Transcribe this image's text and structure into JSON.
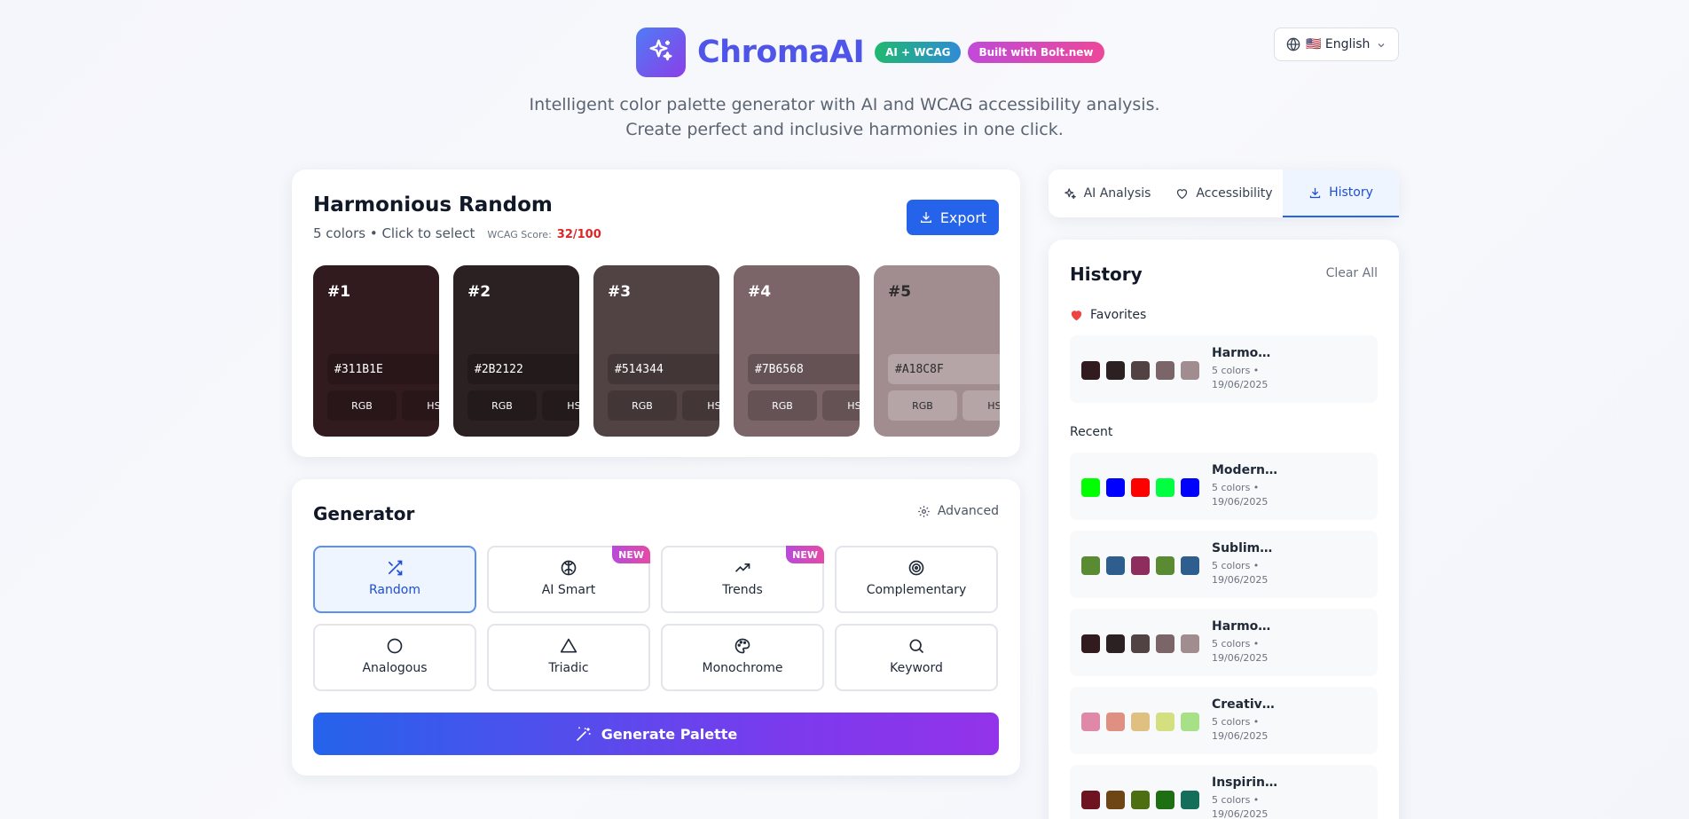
{
  "header": {
    "app_name": "ChromaAI",
    "badges": [
      "AI + WCAG",
      "Built with Bolt.new"
    ],
    "language": "🇺🇸 English",
    "tagline": [
      "Intelligent color palette generator with AI and WCAG accessibility analysis.",
      "Create perfect and inclusive harmonies in one click."
    ]
  },
  "palette": {
    "title": "Harmonious Random",
    "subtitle": "5 colors • Click to select",
    "wcag_label": "WCAG Score:",
    "wcag_score": "32/100",
    "export_label": "Export",
    "swatches": [
      {
        "num": "#1",
        "hex": "#311B1E",
        "color": "#311B1E",
        "btn1": "RGB",
        "btn2": "HSL"
      },
      {
        "num": "#2",
        "hex": "#2B2122",
        "color": "#2B2122",
        "btn1": "RGB",
        "btn2": "HSL"
      },
      {
        "num": "#3",
        "hex": "#514344",
        "color": "#514344",
        "btn1": "RGB",
        "btn2": "HSL"
      },
      {
        "num": "#4",
        "hex": "#7B6568",
        "color": "#7B6568",
        "btn1": "RGB",
        "btn2": "HSL"
      },
      {
        "num": "#5",
        "hex": "#A18C8F",
        "color": "#A18C8F",
        "btn1": "RGB",
        "btn2": "HSL"
      }
    ]
  },
  "generator": {
    "title": "Generator",
    "advanced_label": "Advanced",
    "new_badge": "NEW",
    "modes": [
      {
        "label": "Random",
        "icon": "shuffle-icon",
        "active": true
      },
      {
        "label": "AI Smart",
        "icon": "brain-icon",
        "is_new": true
      },
      {
        "label": "Trends",
        "icon": "trending-up-icon",
        "is_new": true
      },
      {
        "label": "Complementary",
        "icon": "target-icon"
      },
      {
        "label": "Analogous",
        "icon": "circle-icon"
      },
      {
        "label": "Triadic",
        "icon": "triangle-icon"
      },
      {
        "label": "Monochrome",
        "icon": "palette-icon"
      },
      {
        "label": "Keyword",
        "icon": "search-icon"
      }
    ],
    "generate_label": "Generate Palette"
  },
  "tabs": [
    {
      "label": "AI Analysis",
      "icon": "sparkles-icon"
    },
    {
      "label": "Accessibility",
      "icon": "heart-icon"
    },
    {
      "label": "History",
      "icon": "download-icon",
      "active": true
    }
  ],
  "history": {
    "title": "History",
    "clear_label": "Clear All",
    "favorites_label": "Favorites",
    "recent_label": "Recent",
    "favorites": [
      {
        "name": "Harmonious Random",
        "meta1": "5 colors •",
        "meta2": "19/06/2025",
        "colors": [
          "#311B1E",
          "#2B2122",
          "#514344",
          "#7B6568",
          "#A18C8F"
        ]
      }
    ],
    "recent": [
      {
        "name": "Modern Palette",
        "meta1": "5 colors •",
        "meta2": "19/06/2025",
        "colors": [
          "#00FF00",
          "#0000FF",
          "#FF0000",
          "#00FF40",
          "#0000FF"
        ]
      },
      {
        "name": "Sublime Palette",
        "meta1": "5 colors •",
        "meta2": "19/06/2025",
        "colors": [
          "#5A8A32",
          "#2E5E8E",
          "#8E2E5E",
          "#5A8A32",
          "#2E5E8E"
        ]
      },
      {
        "name": "Harmonious Random",
        "meta1": "5 colors •",
        "meta2": "19/06/2025",
        "colors": [
          "#311B1E",
          "#2B2122",
          "#514344",
          "#7B6568",
          "#A18C8F"
        ]
      },
      {
        "name": "Creative Palette",
        "meta1": "5 colors •",
        "meta2": "19/06/2025",
        "colors": [
          "#E088A8",
          "#E09080",
          "#E0C080",
          "#D4E080",
          "#A8E088"
        ]
      },
      {
        "name": "Inspiring Palette",
        "meta1": "5 colors •",
        "meta2": "19/06/2025",
        "colors": [
          "#6E1420",
          "#6E4614",
          "#4E6E14",
          "#1E6E14",
          "#146E5A"
        ]
      }
    ]
  }
}
